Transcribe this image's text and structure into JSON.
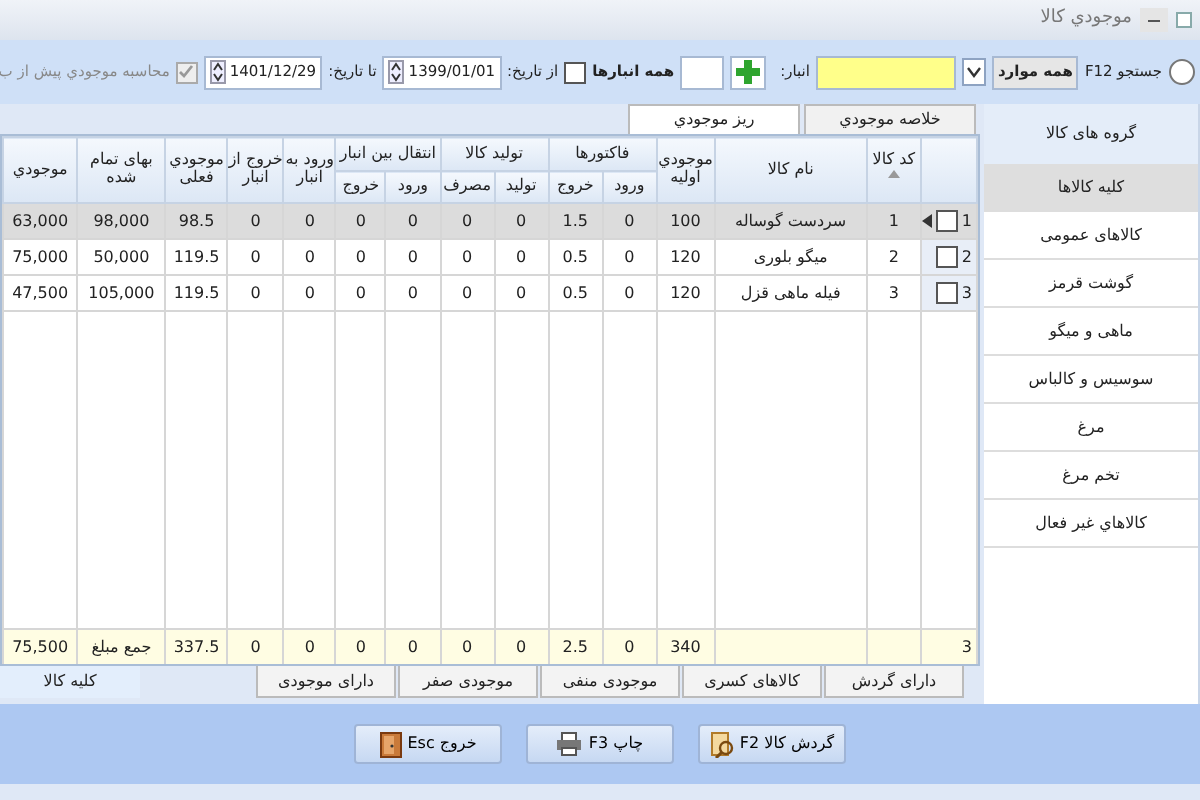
{
  "window": {
    "title": "موجودي کالا"
  },
  "toolbar": {
    "search_label": "جستجو F12",
    "search_mode": {
      "value": "همه موارد"
    },
    "warehouse_label": "انبار:",
    "all_warehouses_label": "همه انبارها",
    "from_date": {
      "label": "از تاریخ:",
      "checked": false,
      "value": "1399/01/01"
    },
    "to_date": {
      "label": "تا تاریخ:",
      "value": "1401/12/29"
    },
    "pre_stock": {
      "label": "محاسبه موجودي پيش از ب",
      "checked": true,
      "disabled": true
    }
  },
  "top_tabs": [
    {
      "label": "خلاصه موجودي",
      "selected": false
    },
    {
      "label": "ريز موجودي",
      "selected": true
    }
  ],
  "sidebar": {
    "title": "گروه های کالا",
    "items": [
      {
        "label": "کلیه کالاها",
        "selected": true
      },
      {
        "label": "کالاهای عمومی",
        "selected": false
      },
      {
        "label": "گوشت قرمز",
        "selected": false
      },
      {
        "label": "ماهی و میگو",
        "selected": false
      },
      {
        "label": "سوسیس و کالباس",
        "selected": false
      },
      {
        "label": "مرغ",
        "selected": false
      },
      {
        "label": "تخم مرغ",
        "selected": false
      },
      {
        "label": "کالاهاي غیر فعال",
        "selected": false
      }
    ]
  },
  "table": {
    "columns": [
      {
        "label": "کد کالا",
        "sorted": true
      },
      {
        "label": "نام کالا"
      },
      {
        "label": "موجودي اوليه"
      },
      {
        "label": "فاکتورها",
        "colspan": 2,
        "subcolumns": [
          "ورود",
          "خروج"
        ]
      },
      {
        "label": "تولید کالا",
        "colspan": 2,
        "subcolumns": [
          "تولید",
          "مصرف"
        ]
      },
      {
        "label": "انتقال بین انبار",
        "colspan": 2,
        "subcolumns": [
          "ورود",
          "خروج"
        ]
      },
      {
        "label": "ورود به انبار"
      },
      {
        "label": "خروج از انبار"
      },
      {
        "label": "موجودي فعلی"
      },
      {
        "label": "بهای تمام شده"
      },
      {
        "label": "موجودي"
      }
    ],
    "rows": [
      {
        "number": "1",
        "selected": true,
        "current": true,
        "checked": false,
        "cells": [
          "1",
          "سردست گوساله",
          "100",
          "0",
          "1.5",
          "0",
          "0",
          "0",
          "0",
          "0",
          "0",
          "98.5",
          "98,000",
          "63,000"
        ]
      },
      {
        "number": "2",
        "selected": false,
        "current": false,
        "checked": false,
        "cells": [
          "2",
          "میگو بلوری",
          "120",
          "0",
          "0.5",
          "0",
          "0",
          "0",
          "0",
          "0",
          "0",
          "119.5",
          "50,000",
          "75,000"
        ]
      },
      {
        "number": "3",
        "selected": false,
        "current": false,
        "checked": false,
        "cells": [
          "3",
          "فیله ماهی قزل",
          "120",
          "0",
          "0.5",
          "0",
          "0",
          "0",
          "0",
          "0",
          "0",
          "119.5",
          "105,000",
          "47,500"
        ]
      }
    ],
    "footer": {
      "count": "3",
      "cells": [
        "",
        "",
        "340",
        "0",
        "2.5",
        "0",
        "0",
        "0",
        "0",
        "0",
        "0",
        "337.5",
        "جمع مبلغ",
        "75,500"
      ]
    }
  },
  "bottom_tabs": [
    {
      "label": "دارای گردش",
      "selected": false
    },
    {
      "label": "کالاهای کسری",
      "selected": false
    },
    {
      "label": "موجودی منفی",
      "selected": false
    },
    {
      "label": "موجودی صفر",
      "selected": false
    },
    {
      "label": "دارای موجودی",
      "selected": false
    },
    {
      "label": "کلیه کالا",
      "selected": true
    }
  ],
  "buttons": [
    {
      "kind": "turnover",
      "label": "گردش کالا F2"
    },
    {
      "kind": "print",
      "label": "چاپ F3"
    },
    {
      "kind": "exit",
      "label": "خروج Esc"
    }
  ]
}
